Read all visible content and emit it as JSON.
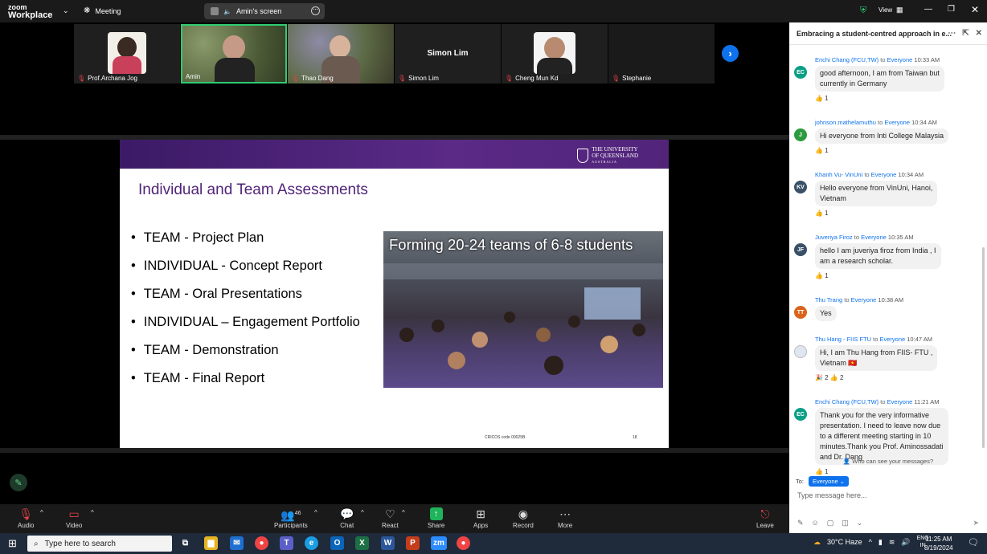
{
  "topbar": {
    "logo_line1": "zoom",
    "logo_line2": "Workplace",
    "meeting_label": "Meeting",
    "share_label": "Amin's screen",
    "view_label": "View"
  },
  "gallery": {
    "participants": [
      {
        "name": "Prof.Archana Jog",
        "muted": true,
        "video": true,
        "face_color": "#3b2a22"
      },
      {
        "name": "Amin",
        "muted": false,
        "video": true,
        "face_color": "#c59a86",
        "active": true
      },
      {
        "name": "Thao Dang",
        "muted": true,
        "video": true,
        "face_color": "#d8b39c"
      },
      {
        "name": "Simon Lim",
        "muted": true,
        "video": false,
        "display_text": "Simon Lim"
      },
      {
        "name": "Cheng Mun Kd",
        "muted": true,
        "video": true,
        "face_color": "#b88a70"
      },
      {
        "name": "Stephanie",
        "muted": true,
        "video": false,
        "display_text": ""
      }
    ]
  },
  "slide": {
    "university_line1": "THE UNIVERSITY",
    "university_line2": "OF QUEENSLAND",
    "university_line3": "AUSTRALIA",
    "title": "Individual and Team Assessments",
    "bullets": [
      "TEAM - Project Plan",
      "INDIVIDUAL - Concept Report",
      "TEAM - Oral Presentations",
      "INDIVIDUAL – Engagement Portfolio",
      "TEAM - Demonstration",
      "TEAM - Final Report"
    ],
    "photo_caption": "Forming 20-24 teams of 6-8 students",
    "cricos": "CRICOS code 00025B",
    "page_number": "18",
    "accent_color": "#51247a"
  },
  "controls": {
    "audio": "Audio",
    "video": "Video",
    "participants": "Participants",
    "participants_count": "46",
    "chat": "Chat",
    "react": "React",
    "share": "Share",
    "apps": "Apps",
    "record": "Record",
    "more": "More",
    "leave": "Leave"
  },
  "chat": {
    "title": "Embracing a student-centred approach in e...",
    "to_word": "to",
    "messages": [
      {
        "initials": "EC",
        "avatar_color": "#0b9f86",
        "sender": "Enchi Chang (FCU,TW)",
        "recipient": "Everyone",
        "time": "10:33 AM",
        "lines": [
          "good afternoon, I am from Taiwan but",
          "currently in Germany"
        ],
        "reactions": "👍 1"
      },
      {
        "initials": "J",
        "avatar_color": "#2c9b3e",
        "sender": "johnson.mathelamuthu",
        "recipient": "Everyone",
        "time": "10:34 AM",
        "lines": [
          "Hi everyone from Inti College Malaysia"
        ],
        "reactions": "👍 1"
      },
      {
        "initials": "KV",
        "avatar_color": "#3a5068",
        "sender": "Khanh Vu- VinUni",
        "recipient": "Everyone",
        "time": "10:34 AM",
        "lines": [
          "Hello everyone from VinUni, Hanoi,",
          "Vietnam"
        ],
        "reactions": "👍 1"
      },
      {
        "initials": "JF",
        "avatar_color": "#3a5068",
        "sender": "Juveriya Firoz",
        "recipient": "Everyone",
        "time": "10:35 AM",
        "lines": [
          "hello I am juveriya firoz from India , I",
          "am a research scholar."
        ],
        "reactions": "👍 1"
      },
      {
        "initials": "TT",
        "avatar_color": "#d9641a",
        "sender": "Thu Trang",
        "recipient": "Everyone",
        "time": "10:38 AM",
        "lines": [
          "Yes"
        ],
        "reactions": ""
      },
      {
        "initials": "",
        "avatar_color": "#dfe6ef",
        "sender": "Thu Hang - FIIS FTU",
        "recipient": "Everyone",
        "time": "10:47 AM",
        "lines": [
          "Hi, I am Thu Hang from FIIS- FTU ,",
          "Vietnam 🇻🇳"
        ],
        "reactions": "🎉 2   👍 2"
      },
      {
        "initials": "EC",
        "avatar_color": "#0b9f86",
        "sender": "Enchi Chang (FCU,TW)",
        "recipient": "Everyone",
        "time": "11:21 AM",
        "lines": [
          "Thank you for the very informative",
          "presentation. I need to leave now due",
          "to a different meeting starting in 10",
          "minutes.Thank you Prof. Aminossadati",
          "and Dr. Dang"
        ],
        "reactions": "👍 1"
      }
    ],
    "who_can_see": "Who can see your messages?",
    "to_label": "To:",
    "to_value": "Everyone",
    "input_placeholder": "Type message here..."
  },
  "taskbar": {
    "search_placeholder": "Type here to search",
    "weather": "30°C  Haze",
    "lang_line1": "ENG",
    "lang_line2": "IN",
    "time": "11:25 AM",
    "date": "8/19/2024"
  }
}
